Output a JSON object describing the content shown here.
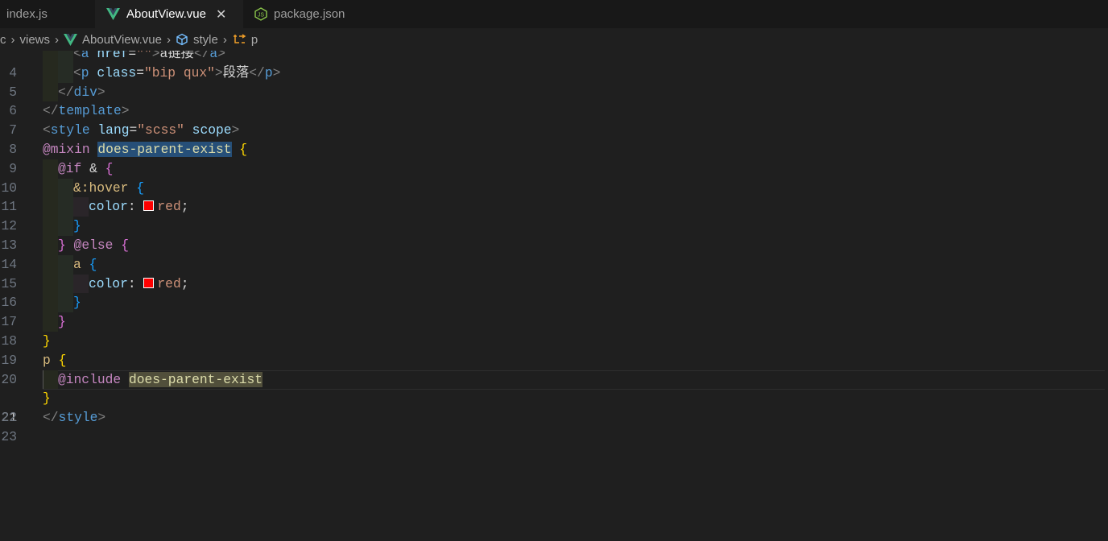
{
  "tabs": [
    {
      "label": "index.js",
      "icon": "js-file-icon",
      "active": false
    },
    {
      "label": "AboutView.vue",
      "icon": "vue-icon",
      "active": true,
      "close": "✕"
    },
    {
      "label": "package.json",
      "icon": "nodejs-icon",
      "active": false
    }
  ],
  "breadcrumb": {
    "items": [
      "c",
      "views",
      "AboutView.vue",
      "style",
      "p"
    ],
    "icons": [
      "",
      "",
      "vue-icon",
      "symbol-structure-icon",
      "symbol-selector-icon"
    ]
  },
  "editor": {
    "current_line": 21,
    "line_numbers": [
      "4",
      "5",
      "6",
      "7",
      "8",
      "9",
      "10",
      "11",
      "12",
      "13",
      "14",
      "15",
      "16",
      "17",
      "18",
      "19",
      "20",
      "21",
      "22",
      "23"
    ],
    "tokens": {
      "l4": [
        "<",
        "a",
        " href",
        "=",
        "\"\"",
        ">",
        "a链接",
        "</",
        "a",
        ">"
      ],
      "l5": [
        "<",
        "p",
        " class",
        "=",
        "\"bip qux\"",
        ">",
        "段落",
        "</",
        "p",
        ">"
      ],
      "l6": [
        "</",
        "div",
        ">"
      ],
      "l7": [
        "</",
        "template",
        ">"
      ],
      "l8": [
        "<",
        "style",
        " lang",
        "=",
        "\"scss\"",
        " scope",
        ">"
      ],
      "l9": [
        "@mixin",
        " ",
        "does-parent-exist",
        " ",
        "{"
      ],
      "l10": [
        "@if",
        " & ",
        "{"
      ],
      "l11": [
        "&:hover",
        " ",
        "{"
      ],
      "l12": [
        "color",
        ": ",
        "red",
        ";"
      ],
      "l13": [
        "}"
      ],
      "l14": [
        "}",
        " ",
        "@else",
        " ",
        "{"
      ],
      "l15": [
        "a",
        " ",
        "{"
      ],
      "l16": [
        "color",
        ": ",
        "red",
        ";"
      ],
      "l17": [
        "}"
      ],
      "l18": [
        "}"
      ],
      "l19": [
        "}"
      ],
      "l20": [
        "p",
        " ",
        "{"
      ],
      "l21": [
        "@include",
        " ",
        "does-parent-exist"
      ],
      "l22": [
        "}"
      ],
      "l23": [
        "</",
        "style",
        ">"
      ]
    },
    "color_swatch": "#ff0000"
  },
  "colors": {
    "background": "#1f1f1f",
    "tabbar": "#181818",
    "vue_green": "#42b883",
    "keyword": "#c586c0",
    "tag": "#569cd6",
    "string": "#ce9178"
  }
}
